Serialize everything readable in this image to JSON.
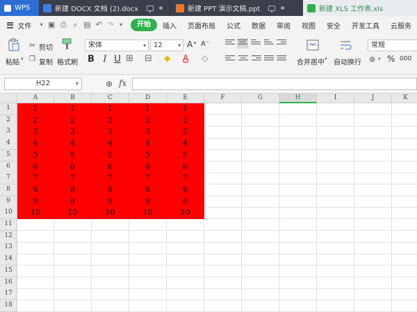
{
  "tabs": [
    {
      "label": "WPS"
    },
    {
      "label": "新建 DOCX 文档 (2).docx"
    },
    {
      "label": "新建 PPT 演示文稿.ppt"
    },
    {
      "label": "新建 XLS 工作表.xls"
    }
  ],
  "menu": {
    "file_label": "文件",
    "items": [
      "开始",
      "插入",
      "页面布局",
      "公式",
      "数据",
      "审阅",
      "视图",
      "安全",
      "开发工具",
      "云服务"
    ],
    "active_index": 0
  },
  "ribbon": {
    "paste_label": "粘贴",
    "cut_label": "剪切",
    "copy_label": "复制",
    "format_painter_label": "格式刷",
    "font_name": "宋体",
    "font_size": "12",
    "bold": "B",
    "italic": "I",
    "underline": "U",
    "merge_center_label": "合并居中",
    "wrap_text_label": "自动换行",
    "number_format": "常规",
    "percent_symbol": "%",
    "comma_symbol": "000"
  },
  "formula_bar": {
    "name_box": "H22",
    "fx_label": "fx",
    "formula": ""
  },
  "grid": {
    "columns": [
      "A",
      "B",
      "C",
      "D",
      "E",
      "F",
      "G",
      "H",
      "I",
      "J",
      "K"
    ],
    "selected_column": "H",
    "row_numbers": [
      "1",
      "2",
      "3",
      "4",
      "5",
      "6",
      "7",
      "8",
      "9",
      "10",
      "11",
      "12",
      "13",
      "14",
      "15",
      "16",
      "17",
      "18"
    ],
    "fill_color": "#ff0000",
    "filled_rows": 10,
    "filled_cols": 5,
    "values": [
      [
        "1",
        "1",
        "1",
        "1",
        "1"
      ],
      [
        "2",
        "2",
        "2",
        "2",
        "2"
      ],
      [
        "3",
        "3",
        "3",
        "3",
        "3"
      ],
      [
        "4",
        "4",
        "4",
        "4",
        "4"
      ],
      [
        "5",
        "5",
        "5",
        "5",
        "5"
      ],
      [
        "6",
        "6",
        "6",
        "6",
        "6"
      ],
      [
        "7",
        "7",
        "7",
        "7",
        "7"
      ],
      [
        "8",
        "8",
        "8",
        "8",
        "8"
      ],
      [
        "9",
        "9",
        "9",
        "9",
        "9"
      ],
      [
        "10",
        "10",
        "10",
        "10",
        "10"
      ]
    ]
  }
}
